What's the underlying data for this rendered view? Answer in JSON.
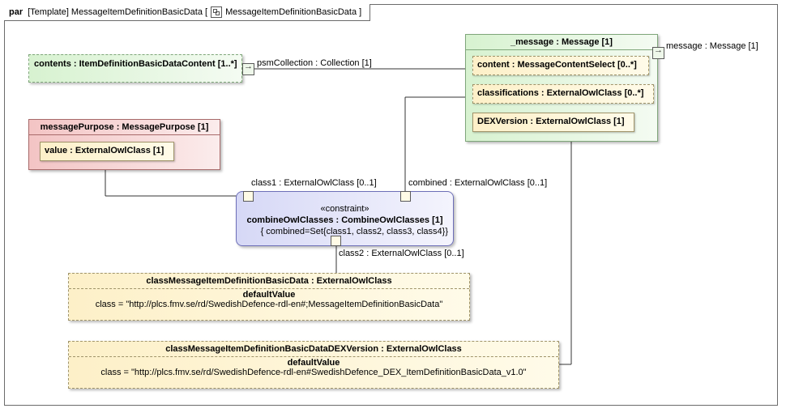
{
  "frame": {
    "kind": "par",
    "title": "[Template] MessageItemDefinitionBasicData [",
    "icon": "parametric-diagram-icon",
    "name": "MessageItemDefinitionBasicData ]"
  },
  "parts": {
    "contents": {
      "label": "contents : ItemDefinitionBasicDataContent [1..*]"
    },
    "messagePurpose": {
      "label": "messagePurpose : MessagePurpose [1]",
      "value_label": "value : ExternalOwlClass [1]"
    },
    "message": {
      "label": "_message : Message [1]",
      "content": "content : MessageContentSelect [0..*]",
      "classifications": "classifications : ExternalOwlClass [0..*]",
      "dex_version": "DEXVersion : ExternalOwlClass [1]"
    },
    "constraint": {
      "stereotype": "«constraint»",
      "name": "combineOwlClasses : CombineOwlClasses [1]",
      "expression": "{ combined=Set{class1, class2, class3, class4}}"
    },
    "class_basic": {
      "title": "classMessageItemDefinitionBasicData : ExternalOwlClass",
      "section": "defaultValue",
      "value": "class = \"http://plcs.fmv.se/rd/SwedishDefence-rdl-en#;MessageItemDefinitionBasicData\""
    },
    "class_dex": {
      "title": "classMessageItemDefinitionBasicDataDEXVersion : ExternalOwlClass",
      "section": "defaultValue",
      "value": "class = \"http://plcs.fmv.se/rd/SwedishDefence-rdl-en#SwedishDefence_DEX_ItemDefinitionBasicData_v1.0\""
    }
  },
  "labels": {
    "psm_collection": "psmCollection : Collection [1]",
    "message_port": "message : Message [1]",
    "class1": "class1 : ExternalOwlClass [0..1]",
    "combined": "combined : ExternalOwlClass [0..1]",
    "class2": "class2 : ExternalOwlClass [0..1]"
  },
  "colors": {
    "green_fill": "#d7f2d0",
    "green_border": "#7fa67a",
    "red_fill": "#f3c4c4",
    "red_border": "#a86a6a",
    "yellow_fill": "#fdf0c8",
    "yellow_border": "#a0946a",
    "constraint_fill": "#d6d8f6",
    "constraint_border": "#6d6fb8"
  }
}
